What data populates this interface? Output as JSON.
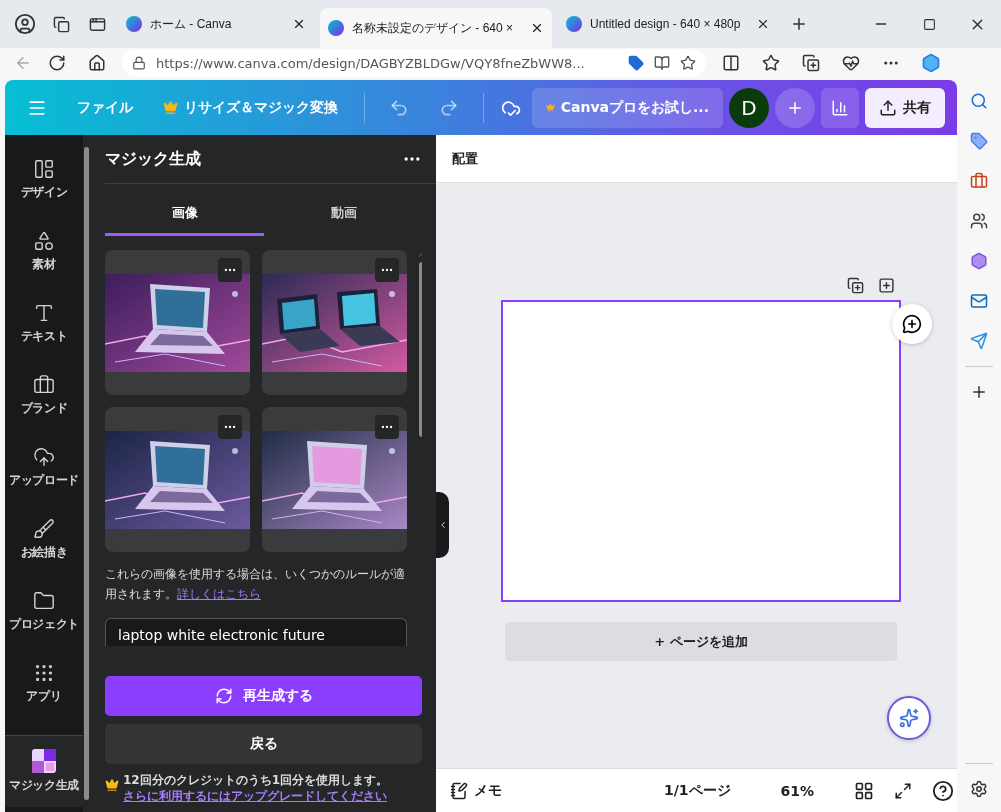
{
  "browser": {
    "tabs": [
      {
        "title": "ホーム - Canva",
        "selected": false
      },
      {
        "title": "名称未設定のデザイン - 640 ×",
        "selected": true
      },
      {
        "title": "Untitled design - 640 × 480p",
        "selected": false
      }
    ],
    "url": "https://www.canva.com/design/DAGBYZBLDGw/VQY8fneZbWW8..."
  },
  "header": {
    "file": "ファイル",
    "resize": "リサイズ＆マジック変換",
    "pro": "Canvaプロをお試し...",
    "avatar": "D",
    "share": "共有"
  },
  "rail": [
    {
      "label": "デザイン",
      "selected": false
    },
    {
      "label": "素材",
      "selected": false
    },
    {
      "label": "テキスト",
      "selected": false
    },
    {
      "label": "ブランド",
      "selected": false
    },
    {
      "label": "アップロード",
      "selected": false
    },
    {
      "label": "お絵描き",
      "selected": false
    },
    {
      "label": "プロジェクト",
      "selected": false
    },
    {
      "label": "アプリ",
      "selected": false
    },
    {
      "label": "マジック生成",
      "selected": true
    }
  ],
  "panel": {
    "title": "マジック生成",
    "tabs": [
      {
        "label": "画像",
        "selected": true
      },
      {
        "label": "動画",
        "selected": false
      }
    ],
    "notice": "これらの画像を使用する場合は、いくつかのルールが適用されます。",
    "notice_link": "詳しくはこちら",
    "prompt": "laptop white electronic future",
    "regenerate": "再生成する",
    "back": "戻る",
    "credits": "12回分のクレジットのうち1回分を使用します。",
    "credits_link": "さらに利用するにはアップグレードしてください"
  },
  "canvas": {
    "toolbar": "配置",
    "add_page": "+ ページを追加",
    "notes": "メモ",
    "pages": "1/1ページ",
    "zoom": "61%"
  }
}
